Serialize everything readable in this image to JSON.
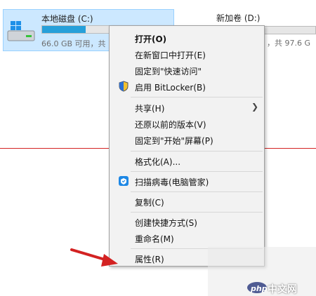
{
  "explorer": {
    "drive_c": {
      "name": "本地磁盘 (C:)",
      "space": "66.0 GB 可用，共",
      "usage_fraction": 0.33
    },
    "drive_d": {
      "name": "新加卷 (D:)",
      "space": "，共 97.6 G"
    }
  },
  "context_menu": {
    "items": [
      {
        "label": "打开(O)"
      },
      {
        "label": "在新窗口中打开(E)"
      },
      {
        "label": "固定到\"快速访问\""
      },
      {
        "label": "启用 BitLocker(B)",
        "icon": "shield-icon"
      },
      {
        "label": "共享(H)"
      },
      {
        "label": "还原以前的版本(V)"
      },
      {
        "label": "固定到\"开始\"屏幕(P)"
      },
      {
        "label": "格式化(A)..."
      },
      {
        "label": "扫描病毒(电脑管家)",
        "icon": "antivirus-icon"
      },
      {
        "label": "复制(C)"
      },
      {
        "label": "创建快捷方式(S)"
      },
      {
        "label": "重命名(M)"
      },
      {
        "label": "属性(R)"
      }
    ]
  },
  "watermark": {
    "text": "中文网",
    "logo": "php"
  },
  "colors": {
    "selection_bg": "#cce8ff",
    "bar_fill": "#26a0da",
    "annotation": "#d32222"
  }
}
